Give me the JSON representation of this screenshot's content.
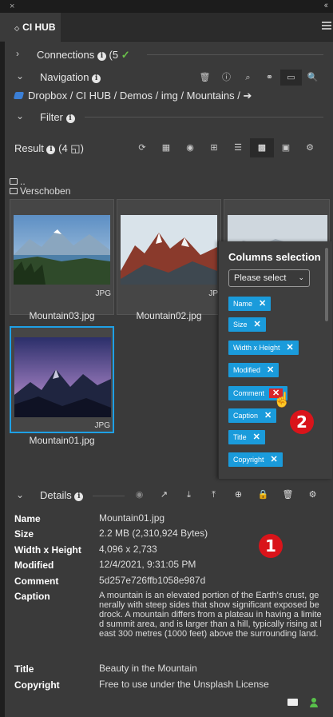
{
  "window": {
    "close_glyph": "×",
    "collapse_glyph": "‹‹"
  },
  "tab": {
    "title": "CI HUB"
  },
  "connections": {
    "label": "Connections",
    "count": "(5",
    "status_glyph": "✓"
  },
  "navigation": {
    "label": "Navigation",
    "icons": [
      "trash-icon",
      "info-square-icon",
      "search-icon",
      "link-icon",
      "folder-icon",
      "search-icon"
    ]
  },
  "breadcrumb": {
    "path": "Dropbox / CI HUB / Demos / img / Mountains /",
    "arrow": "➔"
  },
  "filter": {
    "label": "Filter"
  },
  "result": {
    "label": "Result",
    "count": "(4",
    "tools": [
      "refresh-icon",
      "table-icon",
      "eye-icon",
      "plus-icon",
      "list-icon",
      "grid-icon",
      "card-icon",
      "gear-icon"
    ]
  },
  "folders": [
    {
      "name": ".."
    },
    {
      "name": "Verschoben"
    }
  ],
  "assets": [
    {
      "name": "Mountain03.jpg",
      "ext": "JPG"
    },
    {
      "name": "Mountain02.jpg",
      "ext": "JP"
    },
    {
      "name": "",
      "ext": ""
    },
    {
      "name": "Mountain01.jpg",
      "ext": "JPG"
    }
  ],
  "columns_popup": {
    "title": "Columns selection",
    "select_placeholder": "Please select",
    "chips": [
      "Name",
      "Size",
      "Width x Height",
      "Modified",
      "Comment",
      "Caption",
      "Title",
      "Copyright"
    ]
  },
  "badges": {
    "one": "1",
    "two": "2"
  },
  "details": {
    "label": "Details",
    "rows": [
      {
        "key": "Name",
        "value": "Mountain01.jpg"
      },
      {
        "key": "Size",
        "value": "2.2 MB (2,310,924 Bytes)"
      },
      {
        "key": "Width x Height",
        "value": "4,096 x 2,733"
      },
      {
        "key": "Modified",
        "value": "12/4/2021, 9:31:05 PM"
      },
      {
        "key": "Comment",
        "value": "5d257e726ffb1058e987d"
      },
      {
        "key": "Caption",
        "value": "A mountain is an elevated portion of the Earth's crust, generally with steep sides that show significant exposed bedrock. A mountain differs from a plateau in having a limited summit area, and is larger than a hill, typically rising at least 300 metres (1000 feet) above the surrounding land."
      },
      {
        "key": "Title",
        "value": "Beauty in the Mountain"
      },
      {
        "key": "Copyright",
        "value": "Free to use under the Unsplash License"
      }
    ]
  },
  "colors": {
    "accent": "#1a9bdb",
    "badge": "#d9141a",
    "ok": "#6ac04a",
    "bg": "#3a3a3a"
  }
}
